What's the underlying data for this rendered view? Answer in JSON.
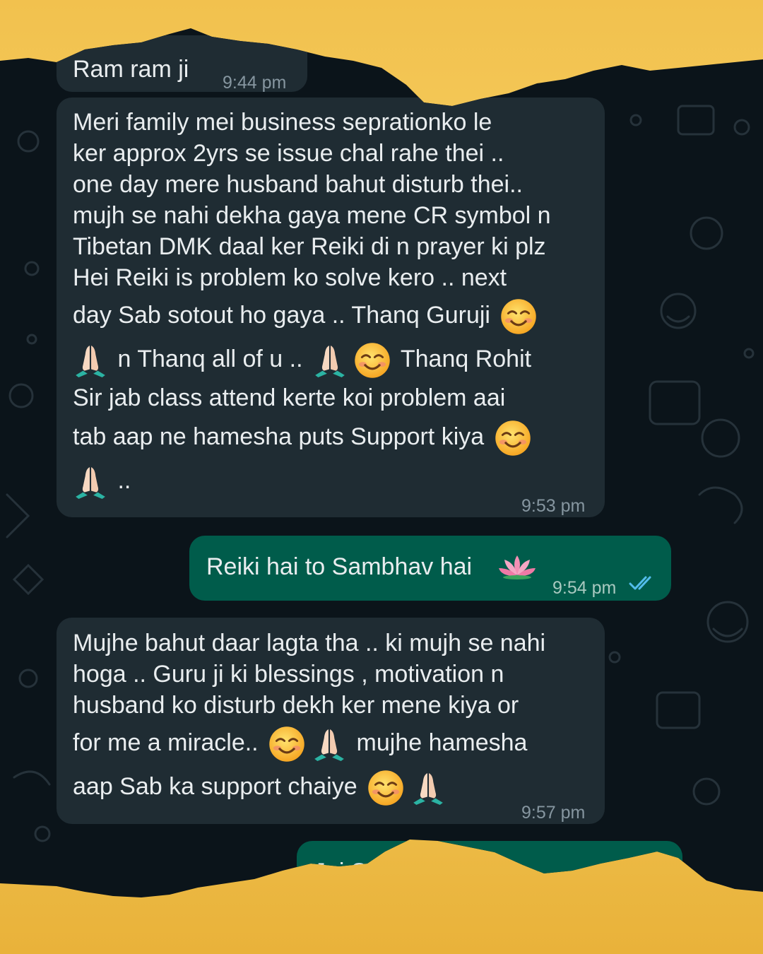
{
  "messages": [
    {
      "direction": "incoming",
      "text": "Ram ram ji",
      "time": "9:44 pm"
    },
    {
      "direction": "incoming",
      "lines": [
        "Meri family mei business seprationko le",
        "ker approx 2yrs se issue chal rahe thei ..",
        "one day mere husband  bahut disturb thei..",
        "mujh se nahi dekha gaya mene CR symbol n",
        "Tibetan DMK daal ker Reiki di n prayer ki plz",
        "Hei Reiki  is problem ko solve kero .. next",
        "day Sab sotout ho gaya .. Thanq Guruji",
        "n Thanq all of u ..",
        "Thanq Rohit",
        "Sir jab class attend kerte koi problem aai",
        "tab aap ne hamesha puts Support kiya",
        ".."
      ],
      "time": "9:53 pm"
    },
    {
      "direction": "outgoing",
      "text": "Reiki hai to Sambhav hai",
      "time": "9:54 pm",
      "status": "read"
    },
    {
      "direction": "incoming",
      "lines": [
        "Mujhe bahut daar lagta tha .. ki mujh se nahi",
        "hoga .. Guru ji ki blessings , motivation n",
        "husband ko disturb dekh ker mene kiya or",
        "for me a miracle..",
        "mujhe hamesha",
        "aap Sab ka support chaiye"
      ],
      "time": "9:57 pm"
    },
    {
      "direction": "outgoing",
      "text": "Jai S",
      "partial": true
    }
  ],
  "icons": {
    "smiling": "smiling-face-icon",
    "pray": "folded-hands-icon",
    "lotus": "lotus-icon",
    "ticks": "double-check-icon"
  },
  "colors": {
    "chat_bg": "#0b141a",
    "incoming_bubble": "#1f2c33",
    "outgoing_bubble": "#005c4b",
    "read_ticks": "#53bdeb",
    "paper": "#f2c14e"
  }
}
